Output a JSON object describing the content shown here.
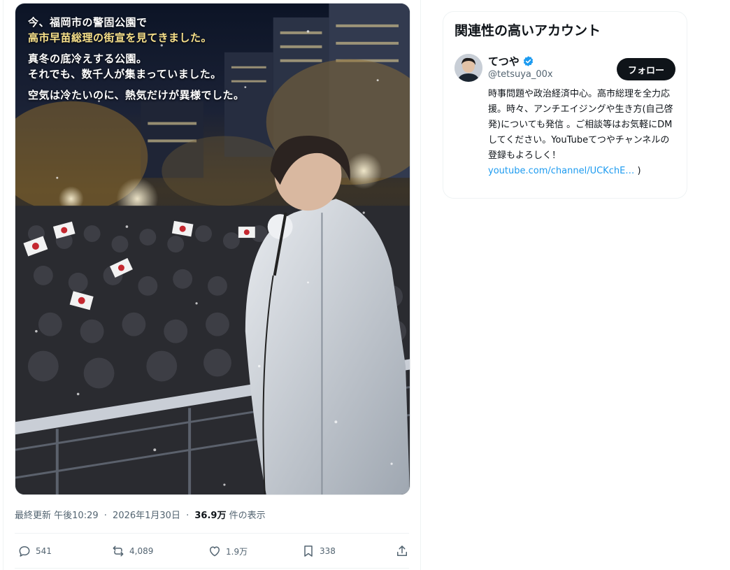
{
  "tweet": {
    "image_text": {
      "line1": "今、福岡市の警固公園で",
      "line2": "高市早苗総理の街宣を見てきました。",
      "line3": "真冬の底冷えする公園。",
      "line4": "それでも、数千人が集まっていました。",
      "line5": "空気は冷たいのに、熱気だけが異様でした。"
    },
    "meta": {
      "prefix": "最終更新",
      "time": "午後10:29",
      "date": "2026年1月30日",
      "views": "36.9万",
      "views_suffix": "件の表示"
    },
    "actions": {
      "replies": "541",
      "reposts": "4,089",
      "likes": "1.9万",
      "bookmarks": "338"
    }
  },
  "sidebar": {
    "title": "関連性の高いアカウント",
    "account": {
      "name": "てつや",
      "handle": "@tetsuya_00x",
      "follow_label": "フォロー",
      "bio_text": "時事問題や政治経済中心。高市総理を全力応援。時々、アンチエイジングや生き方(自己啓発)についても発信 。ご相談等はお気軽にDMしてください。YouTubeてつやチャンネルの登録もよろしく！",
      "bio_link": "youtube.com/channel/UCKchE…",
      "bio_close": ")"
    }
  },
  "colors": {
    "accent": "#1d9bf0",
    "text": "#0f1419",
    "muted": "#536471",
    "button": "#0f1419",
    "highlight_text": "#f7e08a"
  },
  "icons": [
    "reply-icon",
    "repost-icon",
    "like-icon",
    "bookmark-icon",
    "share-icon",
    "verified-icon"
  ]
}
